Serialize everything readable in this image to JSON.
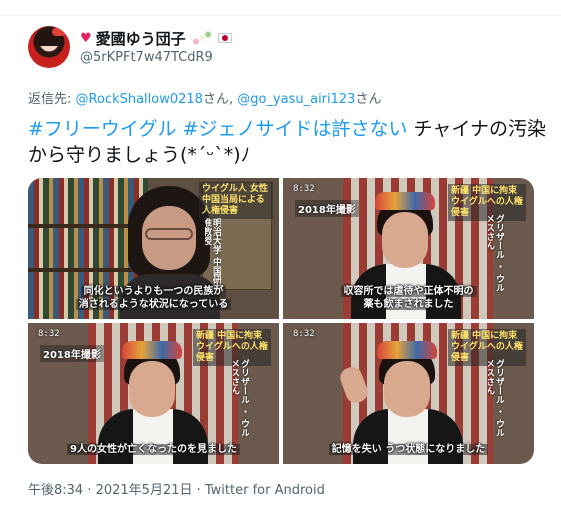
{
  "user": {
    "display_name": "愛國ゆう団子",
    "heart_emoji": "♥",
    "handle": "@5rKPFt7w47TCdR9",
    "avatar_icon": "anime-avatar"
  },
  "reply": {
    "prefix": "返信先: ",
    "mention1": "@RockShallow0218",
    "suffix1": "さん, ",
    "mention2": "@go_yasu_airi123",
    "suffix2": "さん"
  },
  "tweet": {
    "hashtag1": "#フリーウイグル",
    "space1": " ",
    "hashtag2": "#ジェノサイドは許さない",
    "body": " チャイナの汚染から守りましょう(*ˊᵕˋ*)ﾉ"
  },
  "media": {
    "tile1": {
      "subtitle_line1": "同化というよりも一つの民族が",
      "subtitle_line2": "消されるような状況になっている",
      "side_label": "明治大学 中国研究 准教授",
      "headline": "ウイグル人 女性 中国当局による人権侵害"
    },
    "tile2": {
      "timecode": "8:32",
      "year_label": "2018年撮影",
      "headline": "新疆 中国に拘束 ウイグルへの人権侵害",
      "side_label": "グリザール ・ ウルメスさん",
      "subtitle_line1": "収容所では虐待や正体不明の",
      "subtitle_line2": "薬も飲まされました"
    },
    "tile3": {
      "timecode": "8:32",
      "year_label": "2018年撮影",
      "headline": "新疆 中国に拘束 ウイグルへの人権侵害",
      "side_label": "グリザール ・ ウルメスさん",
      "subtitle_line1": "9人の女性が亡くなったのを見ました"
    },
    "tile4": {
      "timecode": "8:32",
      "headline": "新疆 中国に拘束 ウイグルへの人権侵害",
      "side_label": "グリザール ・ ウルメスさん",
      "subtitle_line1": "記憶を失い うつ状態になりました"
    }
  },
  "timestamp": {
    "text": "午後8:34 · 2021年5月21日 · ",
    "source": "Twitter for Android"
  },
  "colors": {
    "link": "#1d9bf0",
    "text": "#0f1419",
    "muted": "#536471"
  }
}
